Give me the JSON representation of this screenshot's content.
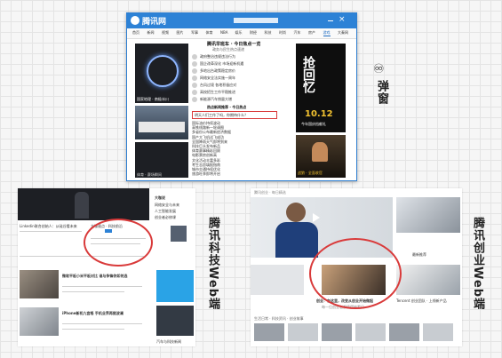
{
  "popup": {
    "app_title": "腾讯网",
    "headline": "腾讯早班车 · 今日焦点一览",
    "sub_headline": "政务与民生热点速递",
    "tabs": [
      "首页",
      "新闻",
      "视频",
      "图片",
      "军事",
      "体育",
      "NBA",
      "娱乐",
      "财经",
      "科技",
      "时尚",
      "汽车",
      "房产",
      "游戏",
      "大秦网"
    ],
    "active_tab_index": 13,
    "list_items": [
      "政府整治违规违法行为",
      "国企改革深化 市场迎新机遇",
      "多地出台政策稳定房价",
      "网络安全法实施一周年",
      "台风过境 各地积极应对",
      "高校招生工作平稳推进",
      "新能源汽车销量大增"
    ],
    "mid_heading": "热点新闻推荐 · 今日热点",
    "highlight_text": "明天人们工作了吗，你期待什么？",
    "list_items_2": [
      "国际油价持续波动",
      "高铁线路新一轮调图",
      "多省份公布最新经济数据",
      "国产大飞机试飞成功",
      "全国降雨天气即将到来",
      "科技巨头发布新品",
      "体育赛事精彩回顾",
      "电影票房创新高",
      "文化活动丰富多彩",
      "考生志愿填报指南",
      "城市交通持续优化",
      "旅游旺季即将开启"
    ],
    "poster_title": "抢回忆",
    "poster_date": "10.12",
    "poster_sub": "今年国庆档献礼",
    "poster2_caption": "战狼 · 全面收官",
    "thumb1_caption": "国家地理 · 南极冰川",
    "thumb2_caption": "体育 · 赛场瞬间"
  },
  "labels": {
    "popup_label_icon": "♾",
    "popup_label": "弹窗",
    "tech_label": "腾讯科技Web端",
    "startup_label": "腾讯创业Web端"
  },
  "web_left": {
    "intro_text": "Linkedin联合创始人：从硅谷看未来",
    "tag_text": "大咖观点 · 科技前沿",
    "sidebar_title": "大咖说",
    "sidebar_items": [
      "网络安全与未来",
      "人工智能发展",
      "创业者必修课"
    ],
    "article1_title": "微软平板小米平板对比 谁与争锋你如何选",
    "article2_title": "iPhone新机九宫格 手机业界再掀波澜",
    "footer_text": "汽车与科技新闻"
  },
  "web_right": {
    "top_strip": "腾讯创业 · 每日精选",
    "caption_main": "创业：在这里，改变从创业开始做起",
    "caption_sub": "每一位创业者都值得被看见",
    "side_label": "最新推荐",
    "side_caption": "Tencent 创业团队 · 上线新产品",
    "bottom_row": "生活日常 · 科技资讯 · 创业故事"
  },
  "colors": {
    "accent_blue": "#2d82d6",
    "circle_red": "#d93a3a",
    "poster_yellow": "#f2c230"
  }
}
